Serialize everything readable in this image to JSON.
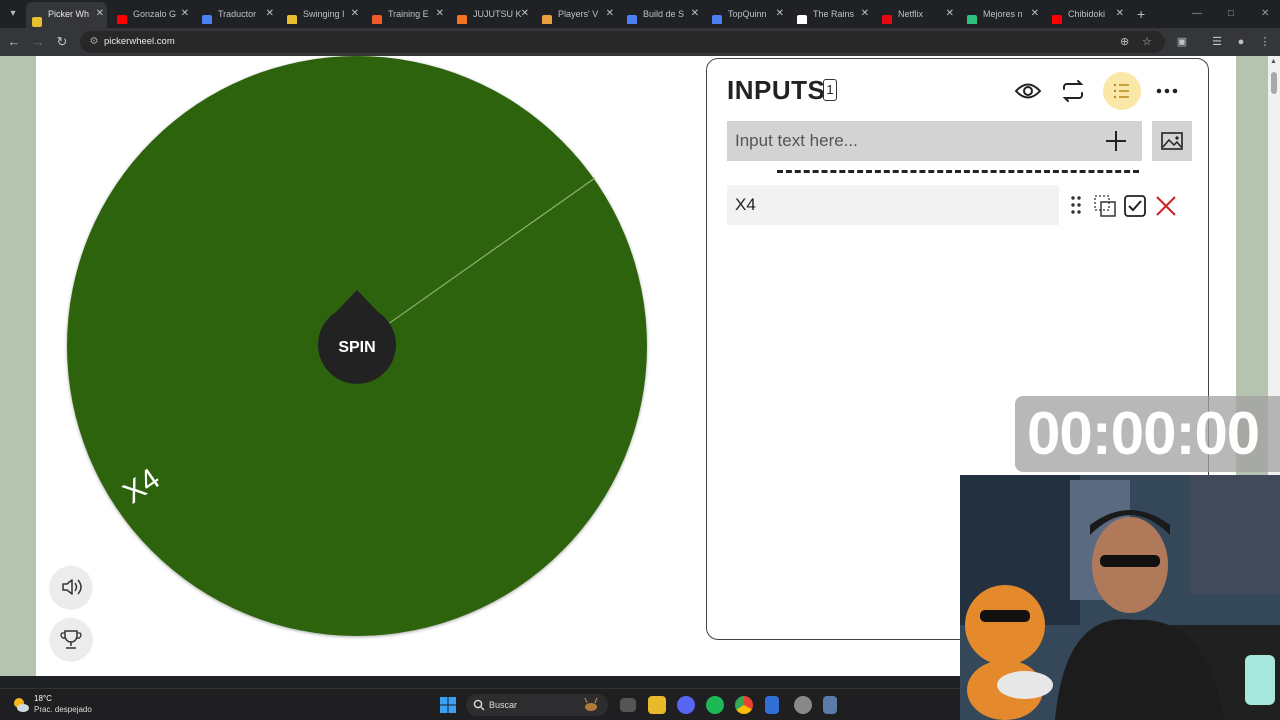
{
  "browser": {
    "tabs": [
      {
        "title": "Picker Wh",
        "color": "#e8c02f",
        "active": true
      },
      {
        "title": "Gonzalo G",
        "color": "#ff0000"
      },
      {
        "title": "Traductor",
        "color": "#4a80f0"
      },
      {
        "title": "Swinging I",
        "color": "#e8c02f"
      },
      {
        "title": "Training E",
        "color": "#f05a28"
      },
      {
        "title": "JUJUTSU K",
        "color": "#f47521"
      },
      {
        "title": "Players' V",
        "color": "#e8a040"
      },
      {
        "title": "Build de S",
        "color": "#4a80f0"
      },
      {
        "title": "TopQuinn",
        "color": "#4a80f0"
      },
      {
        "title": "The Rains",
        "color": "#ffffff"
      },
      {
        "title": "Netflix",
        "color": "#e50914"
      },
      {
        "title": "Mejores n",
        "color": "#2ec27e"
      },
      {
        "title": "Chibidoki",
        "color": "#ff0000"
      }
    ],
    "url": "pickerwheel.com"
  },
  "wheel": {
    "color": "#2f6311",
    "spin_label": "SPIN",
    "segment_label": "X4"
  },
  "inputs_panel": {
    "title": "INPUTS",
    "count": "1",
    "input_placeholder": "Input text here...",
    "entries": [
      {
        "text": "X4"
      }
    ]
  },
  "overlay": {
    "timer": "00:00:00"
  },
  "taskbar": {
    "weather_temp": "18°C",
    "weather_desc": "Prac. despejado",
    "search_label": "Buscar"
  }
}
